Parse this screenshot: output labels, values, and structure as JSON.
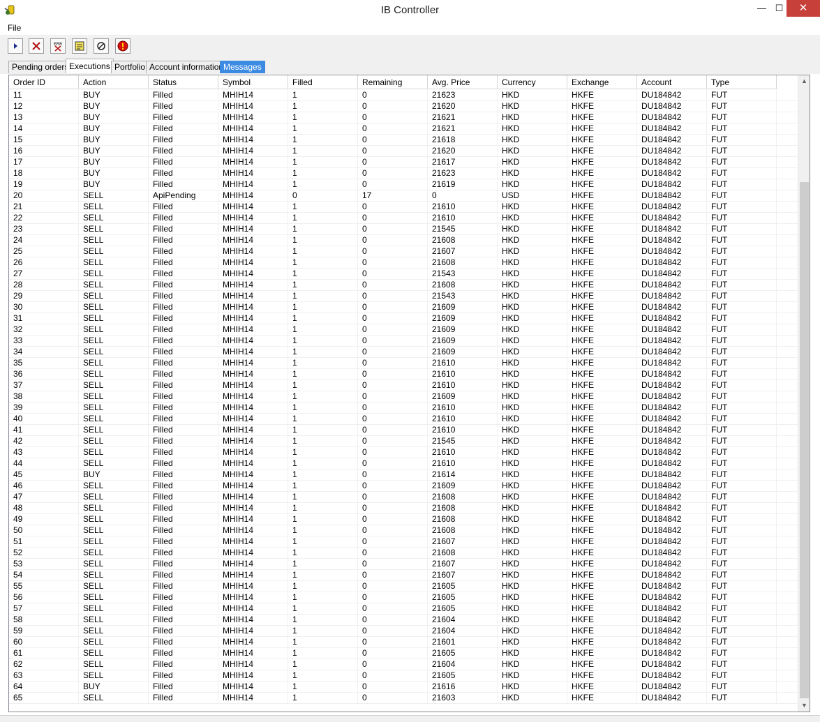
{
  "window": {
    "title": "IB Controller",
    "minimize": "—",
    "maximize": "☐",
    "close": "✕"
  },
  "menu": {
    "file": "File"
  },
  "toolbar": [
    "play-icon",
    "cancel-icon",
    "error-clear-icon",
    "note-icon",
    "refresh-link-icon",
    "alert-icon"
  ],
  "tabs": [
    {
      "label": "Pending orders"
    },
    {
      "label": "Executions"
    },
    {
      "label": "Portfolio"
    },
    {
      "label": "Account information"
    },
    {
      "label": "Messages"
    }
  ],
  "table": {
    "columns": [
      "Order ID",
      "Action",
      "Status",
      "Symbol",
      "Filled",
      "Remaining",
      "Avg. Price",
      "Currency",
      "Exchange",
      "Account",
      "Type"
    ],
    "rows": [
      [
        "11",
        "BUY",
        "Filled",
        "MHIH14",
        "1",
        "0",
        "21623",
        "HKD",
        "HKFE",
        "DU184842",
        "FUT"
      ],
      [
        "12",
        "BUY",
        "Filled",
        "MHIH14",
        "1",
        "0",
        "21620",
        "HKD",
        "HKFE",
        "DU184842",
        "FUT"
      ],
      [
        "13",
        "BUY",
        "Filled",
        "MHIH14",
        "1",
        "0",
        "21621",
        "HKD",
        "HKFE",
        "DU184842",
        "FUT"
      ],
      [
        "14",
        "BUY",
        "Filled",
        "MHIH14",
        "1",
        "0",
        "21621",
        "HKD",
        "HKFE",
        "DU184842",
        "FUT"
      ],
      [
        "15",
        "BUY",
        "Filled",
        "MHIH14",
        "1",
        "0",
        "21618",
        "HKD",
        "HKFE",
        "DU184842",
        "FUT"
      ],
      [
        "16",
        "BUY",
        "Filled",
        "MHIH14",
        "1",
        "0",
        "21620",
        "HKD",
        "HKFE",
        "DU184842",
        "FUT"
      ],
      [
        "17",
        "BUY",
        "Filled",
        "MHIH14",
        "1",
        "0",
        "21617",
        "HKD",
        "HKFE",
        "DU184842",
        "FUT"
      ],
      [
        "18",
        "BUY",
        "Filled",
        "MHIH14",
        "1",
        "0",
        "21623",
        "HKD",
        "HKFE",
        "DU184842",
        "FUT"
      ],
      [
        "19",
        "BUY",
        "Filled",
        "MHIH14",
        "1",
        "0",
        "21619",
        "HKD",
        "HKFE",
        "DU184842",
        "FUT"
      ],
      [
        "20",
        "SELL",
        "ApiPending",
        "MHIH14",
        "0",
        "17",
        "0",
        "USD",
        "HKFE",
        "DU184842",
        "FUT"
      ],
      [
        "21",
        "SELL",
        "Filled",
        "MHIH14",
        "1",
        "0",
        "21610",
        "HKD",
        "HKFE",
        "DU184842",
        "FUT"
      ],
      [
        "22",
        "SELL",
        "Filled",
        "MHIH14",
        "1",
        "0",
        "21610",
        "HKD",
        "HKFE",
        "DU184842",
        "FUT"
      ],
      [
        "23",
        "SELL",
        "Filled",
        "MHIH14",
        "1",
        "0",
        "21545",
        "HKD",
        "HKFE",
        "DU184842",
        "FUT"
      ],
      [
        "24",
        "SELL",
        "Filled",
        "MHIH14",
        "1",
        "0",
        "21608",
        "HKD",
        "HKFE",
        "DU184842",
        "FUT"
      ],
      [
        "25",
        "SELL",
        "Filled",
        "MHIH14",
        "1",
        "0",
        "21607",
        "HKD",
        "HKFE",
        "DU184842",
        "FUT"
      ],
      [
        "26",
        "SELL",
        "Filled",
        "MHIH14",
        "1",
        "0",
        "21608",
        "HKD",
        "HKFE",
        "DU184842",
        "FUT"
      ],
      [
        "27",
        "SELL",
        "Filled",
        "MHIH14",
        "1",
        "0",
        "21543",
        "HKD",
        "HKFE",
        "DU184842",
        "FUT"
      ],
      [
        "28",
        "SELL",
        "Filled",
        "MHIH14",
        "1",
        "0",
        "21608",
        "HKD",
        "HKFE",
        "DU184842",
        "FUT"
      ],
      [
        "29",
        "SELL",
        "Filled",
        "MHIH14",
        "1",
        "0",
        "21543",
        "HKD",
        "HKFE",
        "DU184842",
        "FUT"
      ],
      [
        "30",
        "SELL",
        "Filled",
        "MHIH14",
        "1",
        "0",
        "21609",
        "HKD",
        "HKFE",
        "DU184842",
        "FUT"
      ],
      [
        "31",
        "SELL",
        "Filled",
        "MHIH14",
        "1",
        "0",
        "21609",
        "HKD",
        "HKFE",
        "DU184842",
        "FUT"
      ],
      [
        "32",
        "SELL",
        "Filled",
        "MHIH14",
        "1",
        "0",
        "21609",
        "HKD",
        "HKFE",
        "DU184842",
        "FUT"
      ],
      [
        "33",
        "SELL",
        "Filled",
        "MHIH14",
        "1",
        "0",
        "21609",
        "HKD",
        "HKFE",
        "DU184842",
        "FUT"
      ],
      [
        "34",
        "SELL",
        "Filled",
        "MHIH14",
        "1",
        "0",
        "21609",
        "HKD",
        "HKFE",
        "DU184842",
        "FUT"
      ],
      [
        "35",
        "SELL",
        "Filled",
        "MHIH14",
        "1",
        "0",
        "21610",
        "HKD",
        "HKFE",
        "DU184842",
        "FUT"
      ],
      [
        "36",
        "SELL",
        "Filled",
        "MHIH14",
        "1",
        "0",
        "21610",
        "HKD",
        "HKFE",
        "DU184842",
        "FUT"
      ],
      [
        "37",
        "SELL",
        "Filled",
        "MHIH14",
        "1",
        "0",
        "21610",
        "HKD",
        "HKFE",
        "DU184842",
        "FUT"
      ],
      [
        "38",
        "SELL",
        "Filled",
        "MHIH14",
        "1",
        "0",
        "21609",
        "HKD",
        "HKFE",
        "DU184842",
        "FUT"
      ],
      [
        "39",
        "SELL",
        "Filled",
        "MHIH14",
        "1",
        "0",
        "21610",
        "HKD",
        "HKFE",
        "DU184842",
        "FUT"
      ],
      [
        "40",
        "SELL",
        "Filled",
        "MHIH14",
        "1",
        "0",
        "21610",
        "HKD",
        "HKFE",
        "DU184842",
        "FUT"
      ],
      [
        "41",
        "SELL",
        "Filled",
        "MHIH14",
        "1",
        "0",
        "21610",
        "HKD",
        "HKFE",
        "DU184842",
        "FUT"
      ],
      [
        "42",
        "SELL",
        "Filled",
        "MHIH14",
        "1",
        "0",
        "21545",
        "HKD",
        "HKFE",
        "DU184842",
        "FUT"
      ],
      [
        "43",
        "SELL",
        "Filled",
        "MHIH14",
        "1",
        "0",
        "21610",
        "HKD",
        "HKFE",
        "DU184842",
        "FUT"
      ],
      [
        "44",
        "SELL",
        "Filled",
        "MHIH14",
        "1",
        "0",
        "21610",
        "HKD",
        "HKFE",
        "DU184842",
        "FUT"
      ],
      [
        "45",
        "BUY",
        "Filled",
        "MHIH14",
        "1",
        "0",
        "21614",
        "HKD",
        "HKFE",
        "DU184842",
        "FUT"
      ],
      [
        "46",
        "SELL",
        "Filled",
        "MHIH14",
        "1",
        "0",
        "21609",
        "HKD",
        "HKFE",
        "DU184842",
        "FUT"
      ],
      [
        "47",
        "SELL",
        "Filled",
        "MHIH14",
        "1",
        "0",
        "21608",
        "HKD",
        "HKFE",
        "DU184842",
        "FUT"
      ],
      [
        "48",
        "SELL",
        "Filled",
        "MHIH14",
        "1",
        "0",
        "21608",
        "HKD",
        "HKFE",
        "DU184842",
        "FUT"
      ],
      [
        "49",
        "SELL",
        "Filled",
        "MHIH14",
        "1",
        "0",
        "21608",
        "HKD",
        "HKFE",
        "DU184842",
        "FUT"
      ],
      [
        "50",
        "SELL",
        "Filled",
        "MHIH14",
        "1",
        "0",
        "21608",
        "HKD",
        "HKFE",
        "DU184842",
        "FUT"
      ],
      [
        "51",
        "SELL",
        "Filled",
        "MHIH14",
        "1",
        "0",
        "21607",
        "HKD",
        "HKFE",
        "DU184842",
        "FUT"
      ],
      [
        "52",
        "SELL",
        "Filled",
        "MHIH14",
        "1",
        "0",
        "21608",
        "HKD",
        "HKFE",
        "DU184842",
        "FUT"
      ],
      [
        "53",
        "SELL",
        "Filled",
        "MHIH14",
        "1",
        "0",
        "21607",
        "HKD",
        "HKFE",
        "DU184842",
        "FUT"
      ],
      [
        "54",
        "SELL",
        "Filled",
        "MHIH14",
        "1",
        "0",
        "21607",
        "HKD",
        "HKFE",
        "DU184842",
        "FUT"
      ],
      [
        "55",
        "SELL",
        "Filled",
        "MHIH14",
        "1",
        "0",
        "21605",
        "HKD",
        "HKFE",
        "DU184842",
        "FUT"
      ],
      [
        "56",
        "SELL",
        "Filled",
        "MHIH14",
        "1",
        "0",
        "21605",
        "HKD",
        "HKFE",
        "DU184842",
        "FUT"
      ],
      [
        "57",
        "SELL",
        "Filled",
        "MHIH14",
        "1",
        "0",
        "21605",
        "HKD",
        "HKFE",
        "DU184842",
        "FUT"
      ],
      [
        "58",
        "SELL",
        "Filled",
        "MHIH14",
        "1",
        "0",
        "21604",
        "HKD",
        "HKFE",
        "DU184842",
        "FUT"
      ],
      [
        "59",
        "SELL",
        "Filled",
        "MHIH14",
        "1",
        "0",
        "21604",
        "HKD",
        "HKFE",
        "DU184842",
        "FUT"
      ],
      [
        "60",
        "SELL",
        "Filled",
        "MHIH14",
        "1",
        "0",
        "21601",
        "HKD",
        "HKFE",
        "DU184842",
        "FUT"
      ],
      [
        "61",
        "SELL",
        "Filled",
        "MHIH14",
        "1",
        "0",
        "21605",
        "HKD",
        "HKFE",
        "DU184842",
        "FUT"
      ],
      [
        "62",
        "SELL",
        "Filled",
        "MHIH14",
        "1",
        "0",
        "21604",
        "HKD",
        "HKFE",
        "DU184842",
        "FUT"
      ],
      [
        "63",
        "SELL",
        "Filled",
        "MHIH14",
        "1",
        "0",
        "21605",
        "HKD",
        "HKFE",
        "DU184842",
        "FUT"
      ],
      [
        "64",
        "BUY",
        "Filled",
        "MHIH14",
        "1",
        "0",
        "21616",
        "HKD",
        "HKFE",
        "DU184842",
        "FUT"
      ],
      [
        "65",
        "SELL",
        "Filled",
        "MHIH14",
        "1",
        "0",
        "21603",
        "HKD",
        "HKFE",
        "DU184842",
        "FUT"
      ]
    ]
  },
  "scrollbar": {
    "up": "▲",
    "down": "▼"
  },
  "colors": {
    "close_button": "#c7403a",
    "highlight_tab": "#3c8be3"
  }
}
